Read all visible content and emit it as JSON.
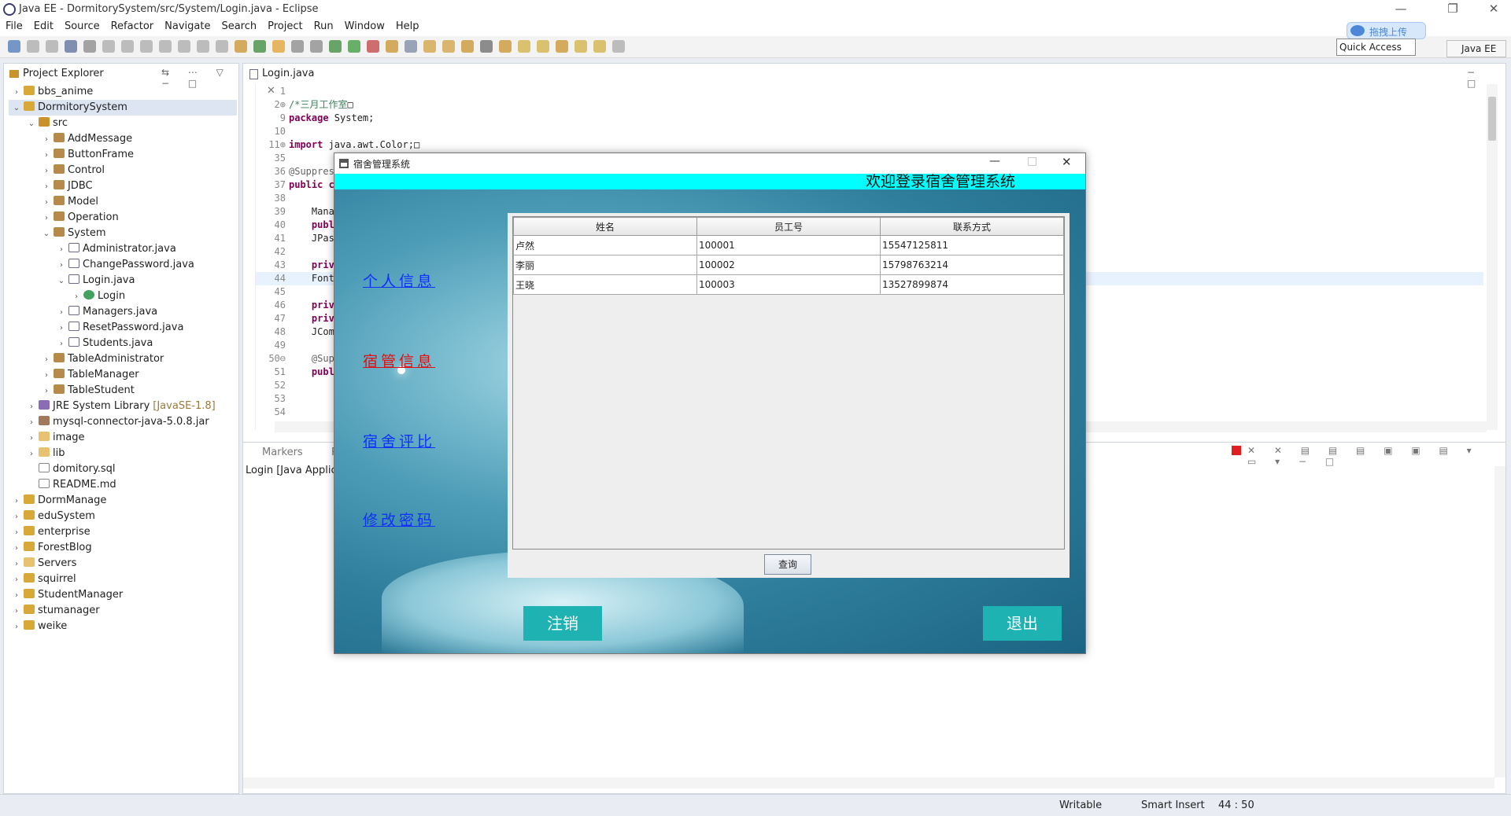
{
  "window": {
    "title": "Java EE - DormitorySystem/src/System/Login.java - Eclipse",
    "min": "—",
    "max": "❐",
    "close": "✕"
  },
  "menu": [
    "File",
    "Edit",
    "Source",
    "Refactor",
    "Navigate",
    "Search",
    "Project",
    "Run",
    "Window",
    "Help"
  ],
  "baidu": {
    "label": "拖拽上传"
  },
  "quick_access": "Quick Access",
  "perspective": "Java EE",
  "project_explorer": {
    "tab_label": "Project Explorer",
    "items": [
      {
        "label": "bbs_anime",
        "depth": 0,
        "arrow": "›",
        "icon": "i-proj"
      },
      {
        "label": "DormitorySystem",
        "depth": 0,
        "arrow": "⌄",
        "icon": "i-proj",
        "selected": true
      },
      {
        "label": "src",
        "depth": 1,
        "arrow": "⌄",
        "icon": "i-src"
      },
      {
        "label": "AddMessage",
        "depth": 2,
        "arrow": "›",
        "icon": "i-pkg"
      },
      {
        "label": "ButtonFrame",
        "depth": 2,
        "arrow": "›",
        "icon": "i-pkg"
      },
      {
        "label": "Control",
        "depth": 2,
        "arrow": "›",
        "icon": "i-pkg"
      },
      {
        "label": "JDBC",
        "depth": 2,
        "arrow": "›",
        "icon": "i-pkg"
      },
      {
        "label": "Model",
        "depth": 2,
        "arrow": "›",
        "icon": "i-pkg"
      },
      {
        "label": "Operation",
        "depth": 2,
        "arrow": "›",
        "icon": "i-pkg"
      },
      {
        "label": "System",
        "depth": 2,
        "arrow": "⌄",
        "icon": "i-pkg"
      },
      {
        "label": "Administrator.java",
        "depth": 3,
        "arrow": "›",
        "icon": "i-java"
      },
      {
        "label": "ChangePassword.java",
        "depth": 3,
        "arrow": "›",
        "icon": "i-java"
      },
      {
        "label": "Login.java",
        "depth": 3,
        "arrow": "⌄",
        "icon": "i-java"
      },
      {
        "label": "Login",
        "depth": 4,
        "arrow": "›",
        "icon": "i-cls"
      },
      {
        "label": "Managers.java",
        "depth": 3,
        "arrow": "›",
        "icon": "i-java"
      },
      {
        "label": "ResetPassword.java",
        "depth": 3,
        "arrow": "›",
        "icon": "i-java"
      },
      {
        "label": "Students.java",
        "depth": 3,
        "arrow": "›",
        "icon": "i-java"
      },
      {
        "label": "TableAdministrator",
        "depth": 2,
        "arrow": "›",
        "icon": "i-pkg"
      },
      {
        "label": "TableManager",
        "depth": 2,
        "arrow": "›",
        "icon": "i-pkg"
      },
      {
        "label": "TableStudent",
        "depth": 2,
        "arrow": "›",
        "icon": "i-pkg"
      },
      {
        "label": "JRE System Library",
        "suffix": "[JavaSE-1.8]",
        "depth": 1,
        "arrow": "›",
        "icon": "i-lib"
      },
      {
        "label": "mysql-connector-java-5.0.8.jar",
        "depth": 1,
        "arrow": "›",
        "icon": "i-jar"
      },
      {
        "label": "image",
        "depth": 1,
        "arrow": "›",
        "icon": "i-fold"
      },
      {
        "label": "lib",
        "depth": 1,
        "arrow": "›",
        "icon": "i-fold"
      },
      {
        "label": "domitory.sql",
        "depth": 1,
        "arrow": "",
        "icon": "i-file"
      },
      {
        "label": "README.md",
        "depth": 1,
        "arrow": "",
        "icon": "i-file"
      },
      {
        "label": "DormManage",
        "depth": 0,
        "arrow": "›",
        "icon": "i-proj"
      },
      {
        "label": "eduSystem",
        "depth": 0,
        "arrow": "›",
        "icon": "i-proj"
      },
      {
        "label": "enterprise",
        "depth": 0,
        "arrow": "›",
        "icon": "i-proj"
      },
      {
        "label": "ForestBlog",
        "depth": 0,
        "arrow": "›",
        "icon": "i-proj"
      },
      {
        "label": "Servers",
        "depth": 0,
        "arrow": "›",
        "icon": "i-fold"
      },
      {
        "label": "squirrel",
        "depth": 0,
        "arrow": "›",
        "icon": "i-proj"
      },
      {
        "label": "StudentManager",
        "depth": 0,
        "arrow": "›",
        "icon": "i-proj"
      },
      {
        "label": "stumanager",
        "depth": 0,
        "arrow": "›",
        "icon": "i-proj"
      },
      {
        "label": "weike",
        "depth": 0,
        "arrow": "›",
        "icon": "i-proj"
      }
    ]
  },
  "editor": {
    "tab_label": "Login.java",
    "lines": [
      {
        "n": "1",
        "parts": []
      },
      {
        "n": "2⊕",
        "parts": [
          {
            "t": "/*三月工作室",
            "c": "cm"
          },
          {
            "t": "□",
            "c": ""
          }
        ]
      },
      {
        "n": "9",
        "parts": [
          {
            "t": "package",
            "c": "kw"
          },
          {
            "t": " System;",
            "c": ""
          }
        ]
      },
      {
        "n": "10",
        "parts": []
      },
      {
        "n": "11⊕",
        "parts": [
          {
            "t": "import",
            "c": "kw"
          },
          {
            "t": " java.awt.Color;□",
            "c": ""
          }
        ]
      },
      {
        "n": "35",
        "parts": []
      },
      {
        "n": "36",
        "parts": [
          {
            "t": "@Suppres",
            "c": "an"
          }
        ]
      },
      {
        "n": "37",
        "parts": [
          {
            "t": "public c",
            "c": "kw"
          }
        ]
      },
      {
        "n": "38",
        "parts": []
      },
      {
        "n": "39",
        "parts": [
          {
            "t": "    Mana",
            "c": ""
          }
        ]
      },
      {
        "n": "40",
        "parts": [
          {
            "t": "    publ",
            "c": "kw"
          }
        ]
      },
      {
        "n": "41",
        "parts": [
          {
            "t": "    JPas",
            "c": ""
          }
        ]
      },
      {
        "n": "42",
        "parts": []
      },
      {
        "n": "43",
        "parts": [
          {
            "t": "    priv",
            "c": "kw"
          }
        ]
      },
      {
        "n": "44",
        "parts": [
          {
            "t": "    Font",
            "c": ""
          }
        ],
        "hl": true
      },
      {
        "n": "45",
        "parts": []
      },
      {
        "n": "46",
        "parts": [
          {
            "t": "    priv",
            "c": "kw"
          }
        ]
      },
      {
        "n": "47",
        "parts": [
          {
            "t": "    priv",
            "c": "kw"
          }
        ]
      },
      {
        "n": "48",
        "parts": [
          {
            "t": "    JCom",
            "c": ""
          }
        ]
      },
      {
        "n": "49",
        "parts": []
      },
      {
        "n": "50⊖",
        "parts": [
          {
            "t": "    @Sup",
            "c": "an"
          }
        ]
      },
      {
        "n": "51",
        "parts": [
          {
            "t": "    publ",
            "c": "kw"
          }
        ]
      },
      {
        "n": "52",
        "parts": []
      },
      {
        "n": "53",
        "parts": []
      },
      {
        "n": "54",
        "parts": []
      }
    ]
  },
  "console": {
    "tab1": "Markers",
    "tab2": "Pr",
    "line": "Login [Java Applicat"
  },
  "status": {
    "writable": "Writable",
    "insert": "Smart Insert",
    "pos": "44 : 50"
  },
  "dialog": {
    "title": "宿舍管理系统",
    "welcome": "欢迎登录宿舍管理系统",
    "nav": [
      {
        "label": "个人信息",
        "color": "#1030ff"
      },
      {
        "label": "宿管信息",
        "color": "#e01010"
      },
      {
        "label": "宿舍评比",
        "color": "#1030ff"
      },
      {
        "label": "修改密码",
        "color": "#1030ff"
      }
    ],
    "table": {
      "headers": [
        "姓名",
        "员工号",
        "联系方式"
      ],
      "rows": [
        [
          "卢然",
          "100001",
          "15547125811"
        ],
        [
          "李丽",
          "100002",
          "15798763214"
        ],
        [
          "王晓",
          "100003",
          "13527899874"
        ]
      ]
    },
    "query_label": "查询",
    "logout_label": "注销",
    "exit_label": "退出",
    "accent": "#1fb2b2"
  }
}
